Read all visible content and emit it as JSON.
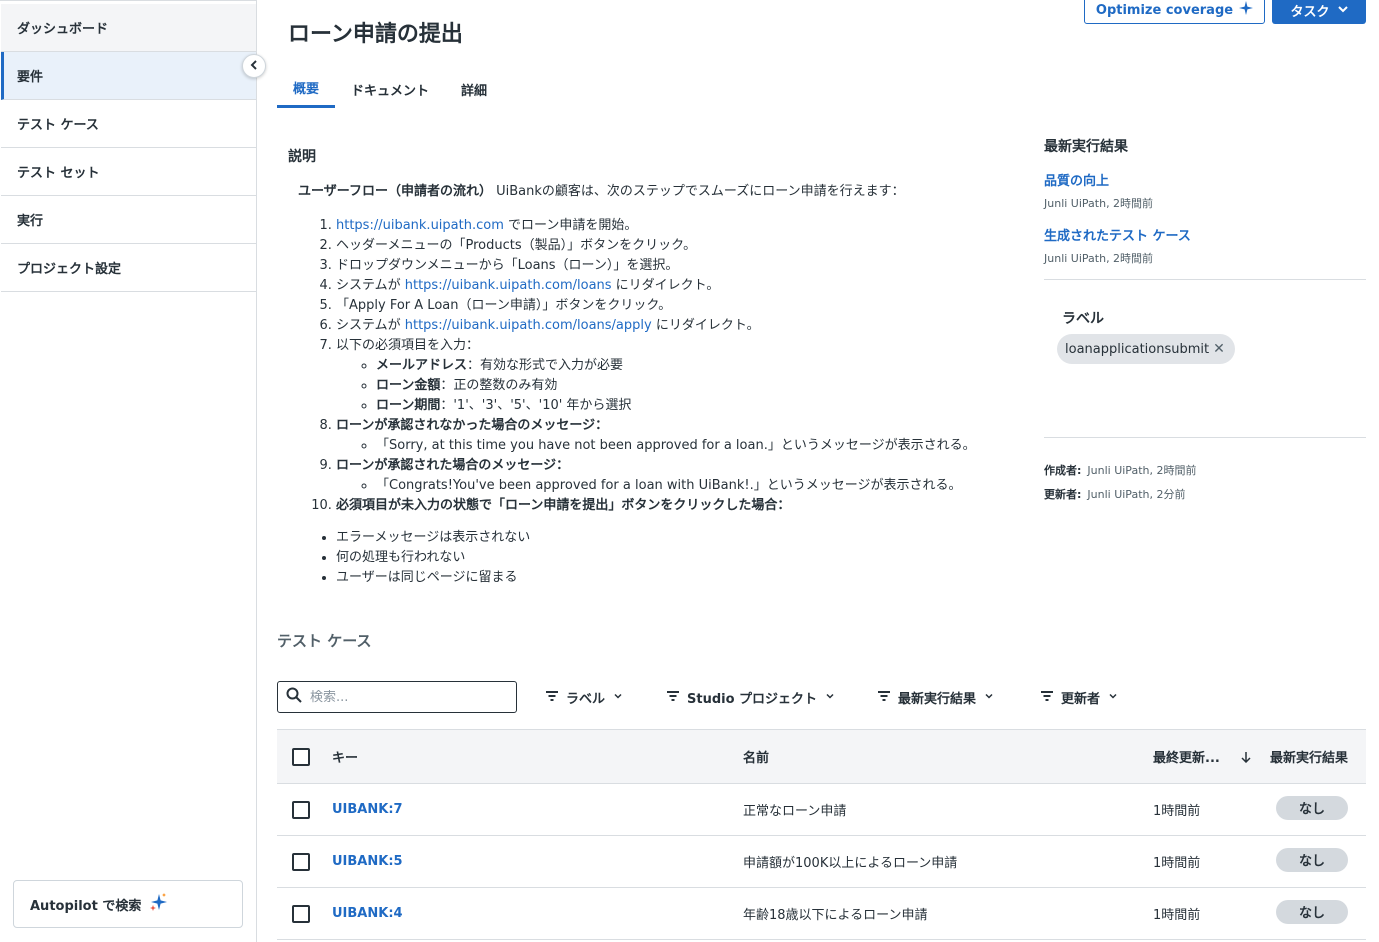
{
  "sidebar": {
    "items": [
      {
        "label": "ダッシュボード"
      },
      {
        "label": "要件"
      },
      {
        "label": "テスト ケース"
      },
      {
        "label": "テスト セット"
      },
      {
        "label": "実行"
      },
      {
        "label": "プロジェクト設定"
      }
    ],
    "autopilot_label": "Autopilot で検索"
  },
  "header": {
    "title": "ローン申請の提出",
    "coverage_button": "Optimize coverage",
    "task_button": "タスク"
  },
  "tabs": [
    {
      "label": "概要"
    },
    {
      "label": "ドキュメント"
    },
    {
      "label": "詳細"
    }
  ],
  "description": {
    "heading": "説明",
    "intro_bold": "ユーザーフロー（申請者の流れ）",
    "intro_text": " UiBankの顧客は、次のステップでスムーズにローン申請を行えます：",
    "steps": {
      "s1_link": "https://uibank.uipath.com",
      "s1_text": " でローン申請を開始。",
      "s2": "ヘッダーメニューの「Products（製品）」ボタンをクリック。",
      "s3": "ドロップダウンメニューから「Loans（ローン）」を選択。",
      "s4_pre": "システムが ",
      "s4_link": "https://uibank.uipath.com/loans",
      "s4_post": " にリダイレクト。",
      "s5": "「Apply For A Loan（ローン申請）」ボタンをクリック。",
      "s6_pre": "システムが ",
      "s6_link": "https://uibank.uipath.com/loans/apply",
      "s6_post": " にリダイレクト。",
      "s7": "以下の必須項目を入力：",
      "s7_a_bold": "メールアドレス",
      "s7_a_text": "：有効な形式で入力が必要",
      "s7_b_bold": "ローン金額",
      "s7_b_text": "：正の整数のみ有効",
      "s7_c_bold": "ローン期間",
      "s7_c_text": "：'1'、'3'、'5'、'10' 年から選択",
      "s8": "ローンが承認されなかった場合のメッセージ：",
      "s8_a": "「Sorry, at this time you have not been approved for a loan.」というメッセージが表示される。",
      "s9": "ローンが承認された場合のメッセージ：",
      "s9_a": "「Congrats!You've been approved for a loan with UiBank!.」というメッセージが表示される。",
      "s10": "必須項目が未入力の状態で「ローン申請を提出」ボタンをクリックした場合："
    },
    "bullets": [
      "エラーメッセージは表示されない",
      "何の処理も行われない",
      "ユーザーは同じページに留まる"
    ]
  },
  "right_panel": {
    "latest_title": "最新実行結果",
    "link1": "品質の向上",
    "meta1": "Junli UiPath, 2時間前",
    "link2": "生成されたテスト ケース",
    "meta2": "Junli UiPath, 2時間前",
    "labels_title": "ラベル",
    "chip": "loanapplicationsubmit",
    "created_label": "作成者:",
    "created_value": "Junli UiPath, 2時間前",
    "updated_label": "更新者:",
    "updated_value": "Junli UiPath, 2分前"
  },
  "test_cases": {
    "title": "テスト ケース",
    "search_placeholder": "検索...",
    "filters": [
      "ラベル",
      "Studio プロジェクト",
      "最新実行結果",
      "更新者"
    ],
    "columns": {
      "key": "キー",
      "name": "名前",
      "updated": "最終更新...",
      "result": "最新実行結果"
    },
    "rows": [
      {
        "key": "UIBANK:7",
        "name": "正常なローン申請",
        "updated": "1時間前",
        "result": "なし"
      },
      {
        "key": "UIBANK:5",
        "name": "申請額が100K以上によるローン申請",
        "updated": "1時間前",
        "result": "なし"
      },
      {
        "key": "UIBANK:4",
        "name": "年齢18歳以下によるローン申請",
        "updated": "1時間前",
        "result": "なし"
      }
    ]
  },
  "colors": {
    "accent": "#1f6ac4",
    "text": "#273139",
    "muted": "#526069",
    "border": "#d9dde1"
  }
}
